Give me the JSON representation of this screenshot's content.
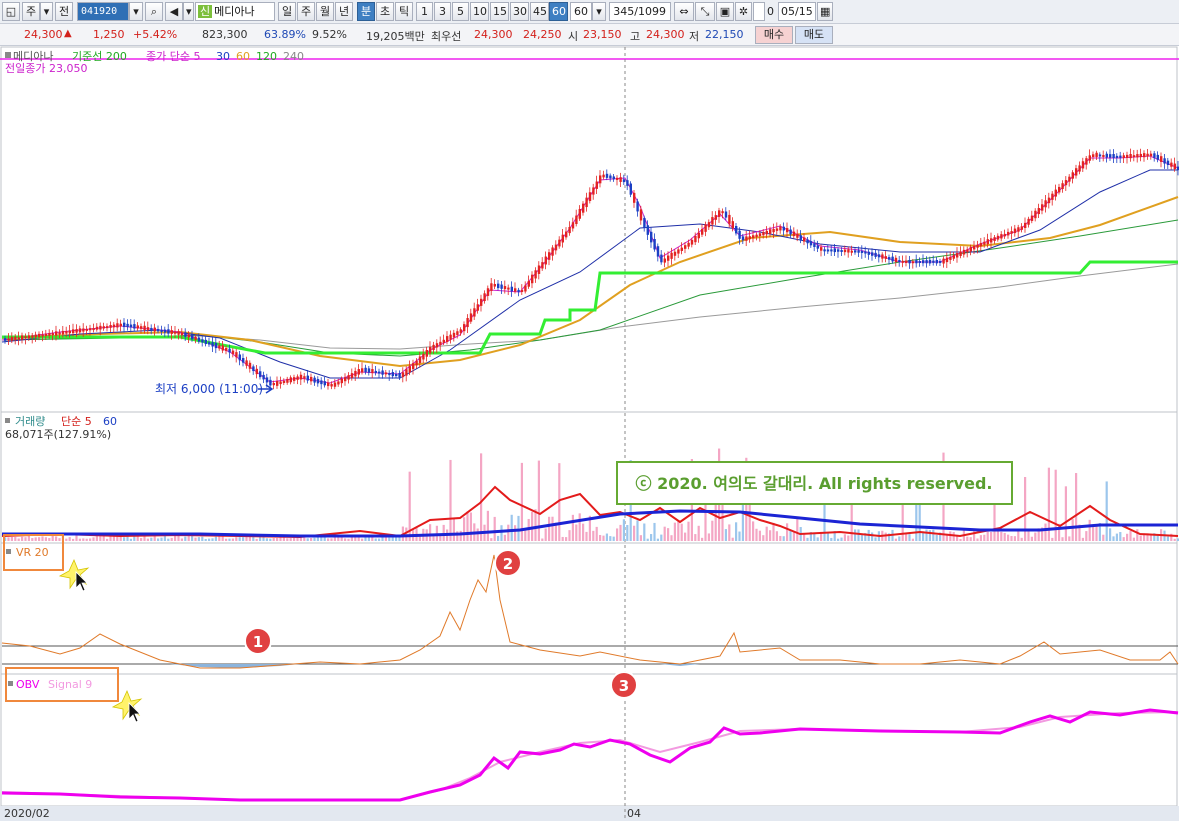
{
  "toolbar": {
    "period_week": "주",
    "prev_label": "전",
    "stock_code": "041920",
    "stock_name_badge": "신",
    "stock_name": "메디아나",
    "tab_day": "일",
    "tab_week": "주",
    "tab_month": "월",
    "tab_year": "년",
    "tab_minute": "분",
    "tab_second": "초",
    "tab_tick": "틱",
    "intervals": [
      "1",
      "3",
      "5",
      "10",
      "15",
      "30",
      "45",
      "60"
    ],
    "interval_value": "60",
    "count_value": "345/1099",
    "checkbox_label": "0",
    "date_value": "05/15"
  },
  "quote": {
    "price": "24,300",
    "change": "1,250",
    "change_pct": "+5.42%",
    "volume": "823,300",
    "ratio1": "63.89%",
    "ratio2": "9.52%",
    "amount": "19,205백만",
    "best_label": "최우선",
    "best_ask": "24,300",
    "best_bid": "24,250",
    "open_label": "시",
    "open": "23,150",
    "high_label": "고",
    "high": "24,300",
    "low_label": "저",
    "low": "22,150",
    "buy_button": "매수",
    "sell_button": "매도"
  },
  "price_pane": {
    "legend_name": "메디아나",
    "legend_base": "기준선 200",
    "legend_ma": "종가 단순 5",
    "ma_periods": [
      "30",
      "60",
      "120",
      "240"
    ],
    "prev_close_label": "전일종가 23,050",
    "low_marker": "최저 6,000 (11:00)"
  },
  "volume_pane": {
    "legend_name": "거래량",
    "legend_ma": "단순 5",
    "legend_ma2": "60",
    "value_label": "68,071주(127.91%)"
  },
  "vr_pane": {
    "legend": "VR 20"
  },
  "obv_pane": {
    "legend_obv": "OBV",
    "legend_signal": "Signal 9"
  },
  "xaxis": {
    "left_label": "2020/02",
    "mid_label": "04"
  },
  "watermark": "ⓒ 2020. 여의도 갈대리. All rights reserved.",
  "markers": [
    "1",
    "2",
    "3"
  ],
  "colors": {
    "up": "#e32222",
    "down": "#1b3fc4",
    "base_line": "#22dd22",
    "ma30": "#e0a020",
    "obv": "#ee00ee",
    "vr": "#e07a2a",
    "marker": "#e04040",
    "highlight_box": "#f0883c"
  }
}
